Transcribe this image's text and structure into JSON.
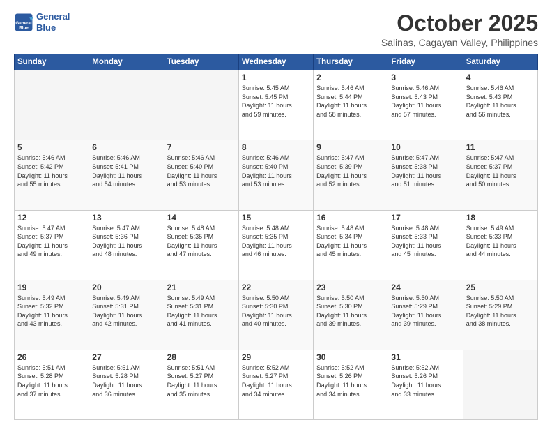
{
  "header": {
    "logo_line1": "General",
    "logo_line2": "Blue",
    "title": "October 2025",
    "subtitle": "Salinas, Cagayan Valley, Philippines"
  },
  "weekdays": [
    "Sunday",
    "Monday",
    "Tuesday",
    "Wednesday",
    "Thursday",
    "Friday",
    "Saturday"
  ],
  "weeks": [
    [
      {
        "day": "",
        "info": ""
      },
      {
        "day": "",
        "info": ""
      },
      {
        "day": "",
        "info": ""
      },
      {
        "day": "1",
        "info": "Sunrise: 5:45 AM\nSunset: 5:45 PM\nDaylight: 11 hours\nand 59 minutes."
      },
      {
        "day": "2",
        "info": "Sunrise: 5:46 AM\nSunset: 5:44 PM\nDaylight: 11 hours\nand 58 minutes."
      },
      {
        "day": "3",
        "info": "Sunrise: 5:46 AM\nSunset: 5:43 PM\nDaylight: 11 hours\nand 57 minutes."
      },
      {
        "day": "4",
        "info": "Sunrise: 5:46 AM\nSunset: 5:43 PM\nDaylight: 11 hours\nand 56 minutes."
      }
    ],
    [
      {
        "day": "5",
        "info": "Sunrise: 5:46 AM\nSunset: 5:42 PM\nDaylight: 11 hours\nand 55 minutes."
      },
      {
        "day": "6",
        "info": "Sunrise: 5:46 AM\nSunset: 5:41 PM\nDaylight: 11 hours\nand 54 minutes."
      },
      {
        "day": "7",
        "info": "Sunrise: 5:46 AM\nSunset: 5:40 PM\nDaylight: 11 hours\nand 53 minutes."
      },
      {
        "day": "8",
        "info": "Sunrise: 5:46 AM\nSunset: 5:40 PM\nDaylight: 11 hours\nand 53 minutes."
      },
      {
        "day": "9",
        "info": "Sunrise: 5:47 AM\nSunset: 5:39 PM\nDaylight: 11 hours\nand 52 minutes."
      },
      {
        "day": "10",
        "info": "Sunrise: 5:47 AM\nSunset: 5:38 PM\nDaylight: 11 hours\nand 51 minutes."
      },
      {
        "day": "11",
        "info": "Sunrise: 5:47 AM\nSunset: 5:37 PM\nDaylight: 11 hours\nand 50 minutes."
      }
    ],
    [
      {
        "day": "12",
        "info": "Sunrise: 5:47 AM\nSunset: 5:37 PM\nDaylight: 11 hours\nand 49 minutes."
      },
      {
        "day": "13",
        "info": "Sunrise: 5:47 AM\nSunset: 5:36 PM\nDaylight: 11 hours\nand 48 minutes."
      },
      {
        "day": "14",
        "info": "Sunrise: 5:48 AM\nSunset: 5:35 PM\nDaylight: 11 hours\nand 47 minutes."
      },
      {
        "day": "15",
        "info": "Sunrise: 5:48 AM\nSunset: 5:35 PM\nDaylight: 11 hours\nand 46 minutes."
      },
      {
        "day": "16",
        "info": "Sunrise: 5:48 AM\nSunset: 5:34 PM\nDaylight: 11 hours\nand 45 minutes."
      },
      {
        "day": "17",
        "info": "Sunrise: 5:48 AM\nSunset: 5:33 PM\nDaylight: 11 hours\nand 45 minutes."
      },
      {
        "day": "18",
        "info": "Sunrise: 5:49 AM\nSunset: 5:33 PM\nDaylight: 11 hours\nand 44 minutes."
      }
    ],
    [
      {
        "day": "19",
        "info": "Sunrise: 5:49 AM\nSunset: 5:32 PM\nDaylight: 11 hours\nand 43 minutes."
      },
      {
        "day": "20",
        "info": "Sunrise: 5:49 AM\nSunset: 5:31 PM\nDaylight: 11 hours\nand 42 minutes."
      },
      {
        "day": "21",
        "info": "Sunrise: 5:49 AM\nSunset: 5:31 PM\nDaylight: 11 hours\nand 41 minutes."
      },
      {
        "day": "22",
        "info": "Sunrise: 5:50 AM\nSunset: 5:30 PM\nDaylight: 11 hours\nand 40 minutes."
      },
      {
        "day": "23",
        "info": "Sunrise: 5:50 AM\nSunset: 5:30 PM\nDaylight: 11 hours\nand 39 minutes."
      },
      {
        "day": "24",
        "info": "Sunrise: 5:50 AM\nSunset: 5:29 PM\nDaylight: 11 hours\nand 39 minutes."
      },
      {
        "day": "25",
        "info": "Sunrise: 5:50 AM\nSunset: 5:29 PM\nDaylight: 11 hours\nand 38 minutes."
      }
    ],
    [
      {
        "day": "26",
        "info": "Sunrise: 5:51 AM\nSunset: 5:28 PM\nDaylight: 11 hours\nand 37 minutes."
      },
      {
        "day": "27",
        "info": "Sunrise: 5:51 AM\nSunset: 5:28 PM\nDaylight: 11 hours\nand 36 minutes."
      },
      {
        "day": "28",
        "info": "Sunrise: 5:51 AM\nSunset: 5:27 PM\nDaylight: 11 hours\nand 35 minutes."
      },
      {
        "day": "29",
        "info": "Sunrise: 5:52 AM\nSunset: 5:27 PM\nDaylight: 11 hours\nand 34 minutes."
      },
      {
        "day": "30",
        "info": "Sunrise: 5:52 AM\nSunset: 5:26 PM\nDaylight: 11 hours\nand 34 minutes."
      },
      {
        "day": "31",
        "info": "Sunrise: 5:52 AM\nSunset: 5:26 PM\nDaylight: 11 hours\nand 33 minutes."
      },
      {
        "day": "",
        "info": ""
      }
    ]
  ]
}
